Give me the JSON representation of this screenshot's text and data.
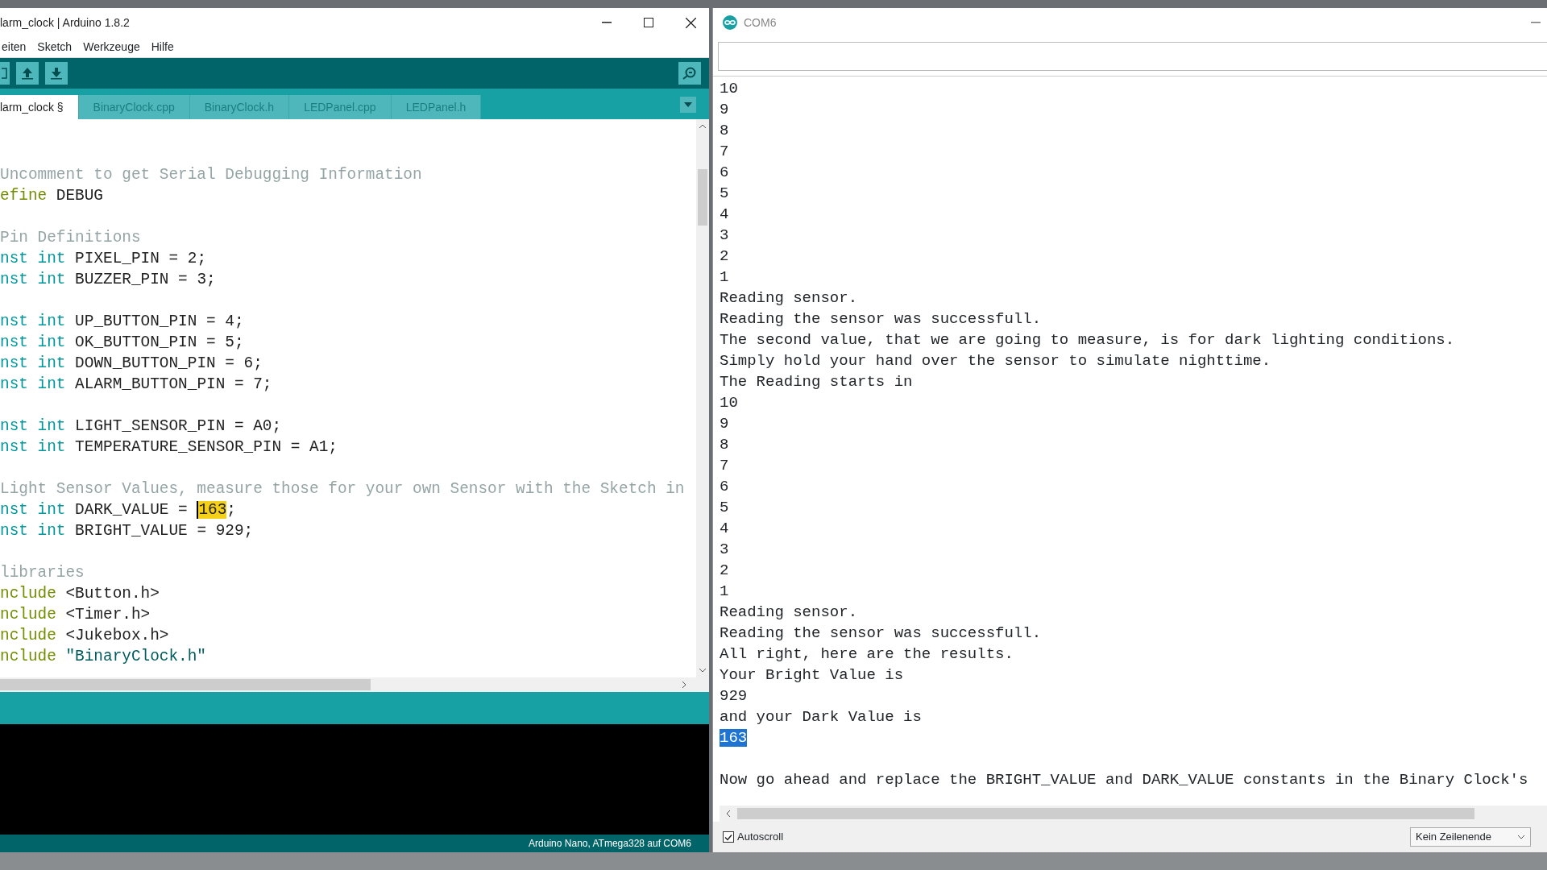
{
  "ide": {
    "title": "larm_clock | Arduino 1.8.2",
    "menu": [
      "eiten",
      "Sketch",
      "Werkzeuge",
      "Hilfe"
    ],
    "tabs": [
      {
        "label": "larm_clock §",
        "selected": true
      },
      {
        "label": "BinaryClock.cpp",
        "selected": false
      },
      {
        "label": "BinaryClock.h",
        "selected": false
      },
      {
        "label": "LEDPanel.cpp",
        "selected": false
      },
      {
        "label": "LEDPanel.h",
        "selected": false
      }
    ],
    "code": [
      {
        "gap_before": true,
        "segments": [
          {
            "kind": "comment",
            "text": "Uncomment to get Serial Debugging Information"
          }
        ]
      },
      {
        "segments": [
          {
            "kind": "keyword",
            "text": "efine"
          },
          {
            "kind": "plain",
            "text": " DEBUG"
          }
        ]
      },
      {
        "gap_before": true,
        "segments": [
          {
            "kind": "comment",
            "text": "Pin Definitions"
          }
        ]
      },
      {
        "segments": [
          {
            "kind": "type",
            "text": "nst int"
          },
          {
            "kind": "plain",
            "text": " PIXEL_PIN = 2;"
          }
        ]
      },
      {
        "segments": [
          {
            "kind": "type",
            "text": "nst int"
          },
          {
            "kind": "plain",
            "text": " BUZZER_PIN = 3;"
          }
        ]
      },
      {
        "gap_before": true,
        "segments": [
          {
            "kind": "type",
            "text": "nst int"
          },
          {
            "kind": "plain",
            "text": " UP_BUTTON_PIN = 4;"
          }
        ]
      },
      {
        "segments": [
          {
            "kind": "type",
            "text": "nst int"
          },
          {
            "kind": "plain",
            "text": " OK_BUTTON_PIN = 5;"
          }
        ]
      },
      {
        "segments": [
          {
            "kind": "type",
            "text": "nst int"
          },
          {
            "kind": "plain",
            "text": " DOWN_BUTTON_PIN = 6;"
          }
        ]
      },
      {
        "segments": [
          {
            "kind": "type",
            "text": "nst int"
          },
          {
            "kind": "plain",
            "text": " ALARM_BUTTON_PIN = 7;"
          }
        ]
      },
      {
        "gap_before": true,
        "segments": [
          {
            "kind": "type",
            "text": "nst int"
          },
          {
            "kind": "plain",
            "text": " LIGHT_SENSOR_PIN = A0;"
          }
        ]
      },
      {
        "segments": [
          {
            "kind": "type",
            "text": "nst int"
          },
          {
            "kind": "plain",
            "text": " TEMPERATURE_SENSOR_PIN = A1;"
          }
        ]
      },
      {
        "gap_before": true,
        "segments": [
          {
            "kind": "comment",
            "text": "Light Sensor Values, measure those for your own Sensor with the Sketch in"
          }
        ]
      },
      {
        "segments": [
          {
            "kind": "type",
            "text": "nst int"
          },
          {
            "kind": "plain",
            "text": " DARK_VALUE = "
          },
          {
            "kind": "highlight",
            "text": "163"
          },
          {
            "kind": "plain",
            "text": ";"
          }
        ]
      },
      {
        "segments": [
          {
            "kind": "type",
            "text": "nst int"
          },
          {
            "kind": "plain",
            "text": " BRIGHT_VALUE = 929;"
          }
        ]
      },
      {
        "gap_before": true,
        "segments": [
          {
            "kind": "comment",
            "text": "libraries"
          }
        ]
      },
      {
        "segments": [
          {
            "kind": "keyword",
            "text": "nclude"
          },
          {
            "kind": "plain",
            "text": " <Button.h>"
          }
        ]
      },
      {
        "segments": [
          {
            "kind": "keyword",
            "text": "nclude"
          },
          {
            "kind": "plain",
            "text": " <Timer.h>"
          }
        ]
      },
      {
        "segments": [
          {
            "kind": "keyword",
            "text": "nclude"
          },
          {
            "kind": "plain",
            "text": " <Jukebox.h>"
          }
        ]
      },
      {
        "segments": [
          {
            "kind": "keyword",
            "text": "nclude"
          },
          {
            "kind": "string",
            "text": " \"BinaryClock.h\""
          }
        ]
      }
    ],
    "status": "Arduino Nano, ATmega328 auf COM6"
  },
  "serial_monitor": {
    "title": "COM6",
    "lines": [
      {
        "text": "10",
        "selected": false
      },
      {
        "text": "9",
        "selected": false
      },
      {
        "text": "8",
        "selected": false
      },
      {
        "text": "7",
        "selected": false
      },
      {
        "text": "6",
        "selected": false
      },
      {
        "text": "5",
        "selected": false
      },
      {
        "text": "4",
        "selected": false
      },
      {
        "text": "3",
        "selected": false
      },
      {
        "text": "2",
        "selected": false
      },
      {
        "text": "1",
        "selected": false
      },
      {
        "text": "Reading sensor.",
        "selected": false
      },
      {
        "text": "Reading the sensor was successfull.",
        "selected": false
      },
      {
        "text": "The second value, that we are going to measure, is for dark lighting conditions.",
        "selected": false
      },
      {
        "text": "Simply hold your hand over the sensor to simulate nighttime.",
        "selected": false
      },
      {
        "text": "The Reading starts in",
        "selected": false
      },
      {
        "text": "10",
        "selected": false
      },
      {
        "text": "9",
        "selected": false
      },
      {
        "text": "8",
        "selected": false
      },
      {
        "text": "7",
        "selected": false
      },
      {
        "text": "6",
        "selected": false
      },
      {
        "text": "5",
        "selected": false
      },
      {
        "text": "4",
        "selected": false
      },
      {
        "text": "3",
        "selected": false
      },
      {
        "text": "2",
        "selected": false
      },
      {
        "text": "1",
        "selected": false
      },
      {
        "text": "Reading sensor.",
        "selected": false
      },
      {
        "text": "Reading the sensor was successfull.",
        "selected": false
      },
      {
        "text": "All right, here are the results.",
        "selected": false
      },
      {
        "text": "Your Bright Value is",
        "selected": false
      },
      {
        "text": "929",
        "selected": false
      },
      {
        "text": "and your Dark Value is",
        "selected": false
      },
      {
        "text": "163",
        "selected": true
      },
      {
        "text": "Now go ahead and replace the BRIGHT_VALUE and DARK_VALUE constants in the Binary Clock's",
        "selected": false,
        "gap_before": true
      }
    ],
    "autoscroll": {
      "label": "Autoscroll",
      "checked": true
    },
    "line_ending": "Kein Zeilenende"
  }
}
